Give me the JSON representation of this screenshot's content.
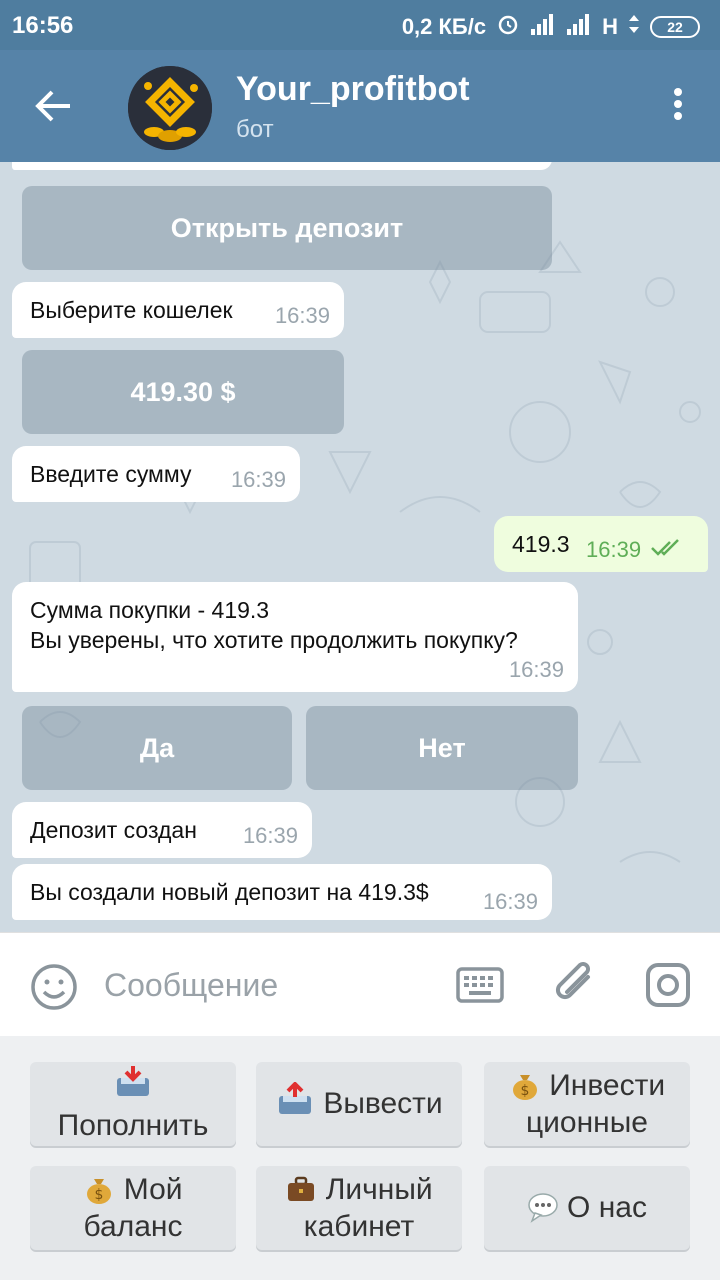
{
  "status": {
    "time": "16:56",
    "speed": "0,2 КБ/с",
    "net": "H",
    "battery": "22"
  },
  "header": {
    "title": "Your_profitbot",
    "subtitle": "бот"
  },
  "chat": {
    "btn_open_deposit": "Открыть депозит",
    "msg_choose_wallet": {
      "text": "Выберите кошелек",
      "time": "16:39"
    },
    "btn_amount": "419.30 $",
    "msg_enter_amount": {
      "text": "Введите сумму",
      "time": "16:39"
    },
    "msg_out_amount": {
      "text": "419.3",
      "time": "16:39"
    },
    "msg_confirm": {
      "line1": "Сумма покупки - 419.3",
      "line2": "Вы уверены, что хотите продолжить покупку?",
      "time": "16:39"
    },
    "btn_yes": "Да",
    "btn_no": "Нет",
    "msg_deposit_created": {
      "text": "Депозит создан",
      "time": "16:39"
    },
    "msg_new_deposit": {
      "text": "Вы создали новый депозит на 419.3$",
      "time": "16:39"
    }
  },
  "input": {
    "placeholder": "Сообщение"
  },
  "keyboard": {
    "replenish": {
      "line1": "",
      "line2": "Пополнить",
      "icon": "inbox-tray-icon"
    },
    "withdraw": {
      "label": "Вывести",
      "icon": "outbox-tray-icon"
    },
    "invest": {
      "line1": "Инвести",
      "line2": "ционные",
      "icon": "money-bag-icon"
    },
    "balance": {
      "line1": "Мой",
      "line2": "баланс",
      "icon": "money-bag-icon"
    },
    "cabinet": {
      "line1": "Личный",
      "line2": "кабинет",
      "icon": "briefcase-icon"
    },
    "about": {
      "label": "О нас",
      "icon": "speech-bubble-icon"
    }
  },
  "colors": {
    "header": "#5683a8",
    "statusbar": "#4f7d9f",
    "out_bubble": "#effdde",
    "check": "#5fae57"
  }
}
